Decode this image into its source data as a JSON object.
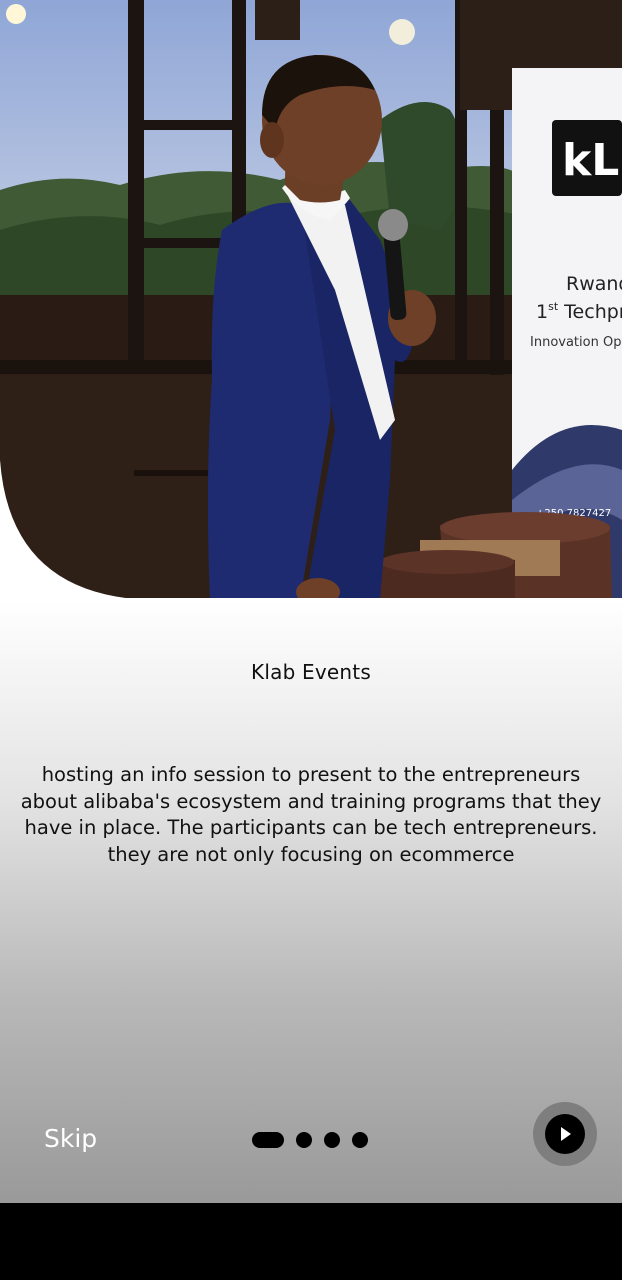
{
  "banner": {
    "logo_text": "kL",
    "line1": "Rwand",
    "line2_prefix": "1",
    "line2_sup": "st",
    "line2_rest": " Techpre",
    "line3": "Innovation Ope",
    "phone": "+250 7827427"
  },
  "slide": {
    "title": "Klab Events",
    "description": "hosting an info session to present to the entrepreneurs about alibaba's ecosystem and training programs that they have in place. The participants can be tech entrepreneurs. they are not only focusing on ecommerce"
  },
  "controls": {
    "skip_label": "Skip",
    "page_count": 4,
    "active_page": 1,
    "next_icon": "play-arrow-icon"
  },
  "colors": {
    "dot": "#000000",
    "next_button_outer": "#7e7e7e",
    "next_button_inner": "#000000",
    "skip_text": "#ffffff"
  }
}
